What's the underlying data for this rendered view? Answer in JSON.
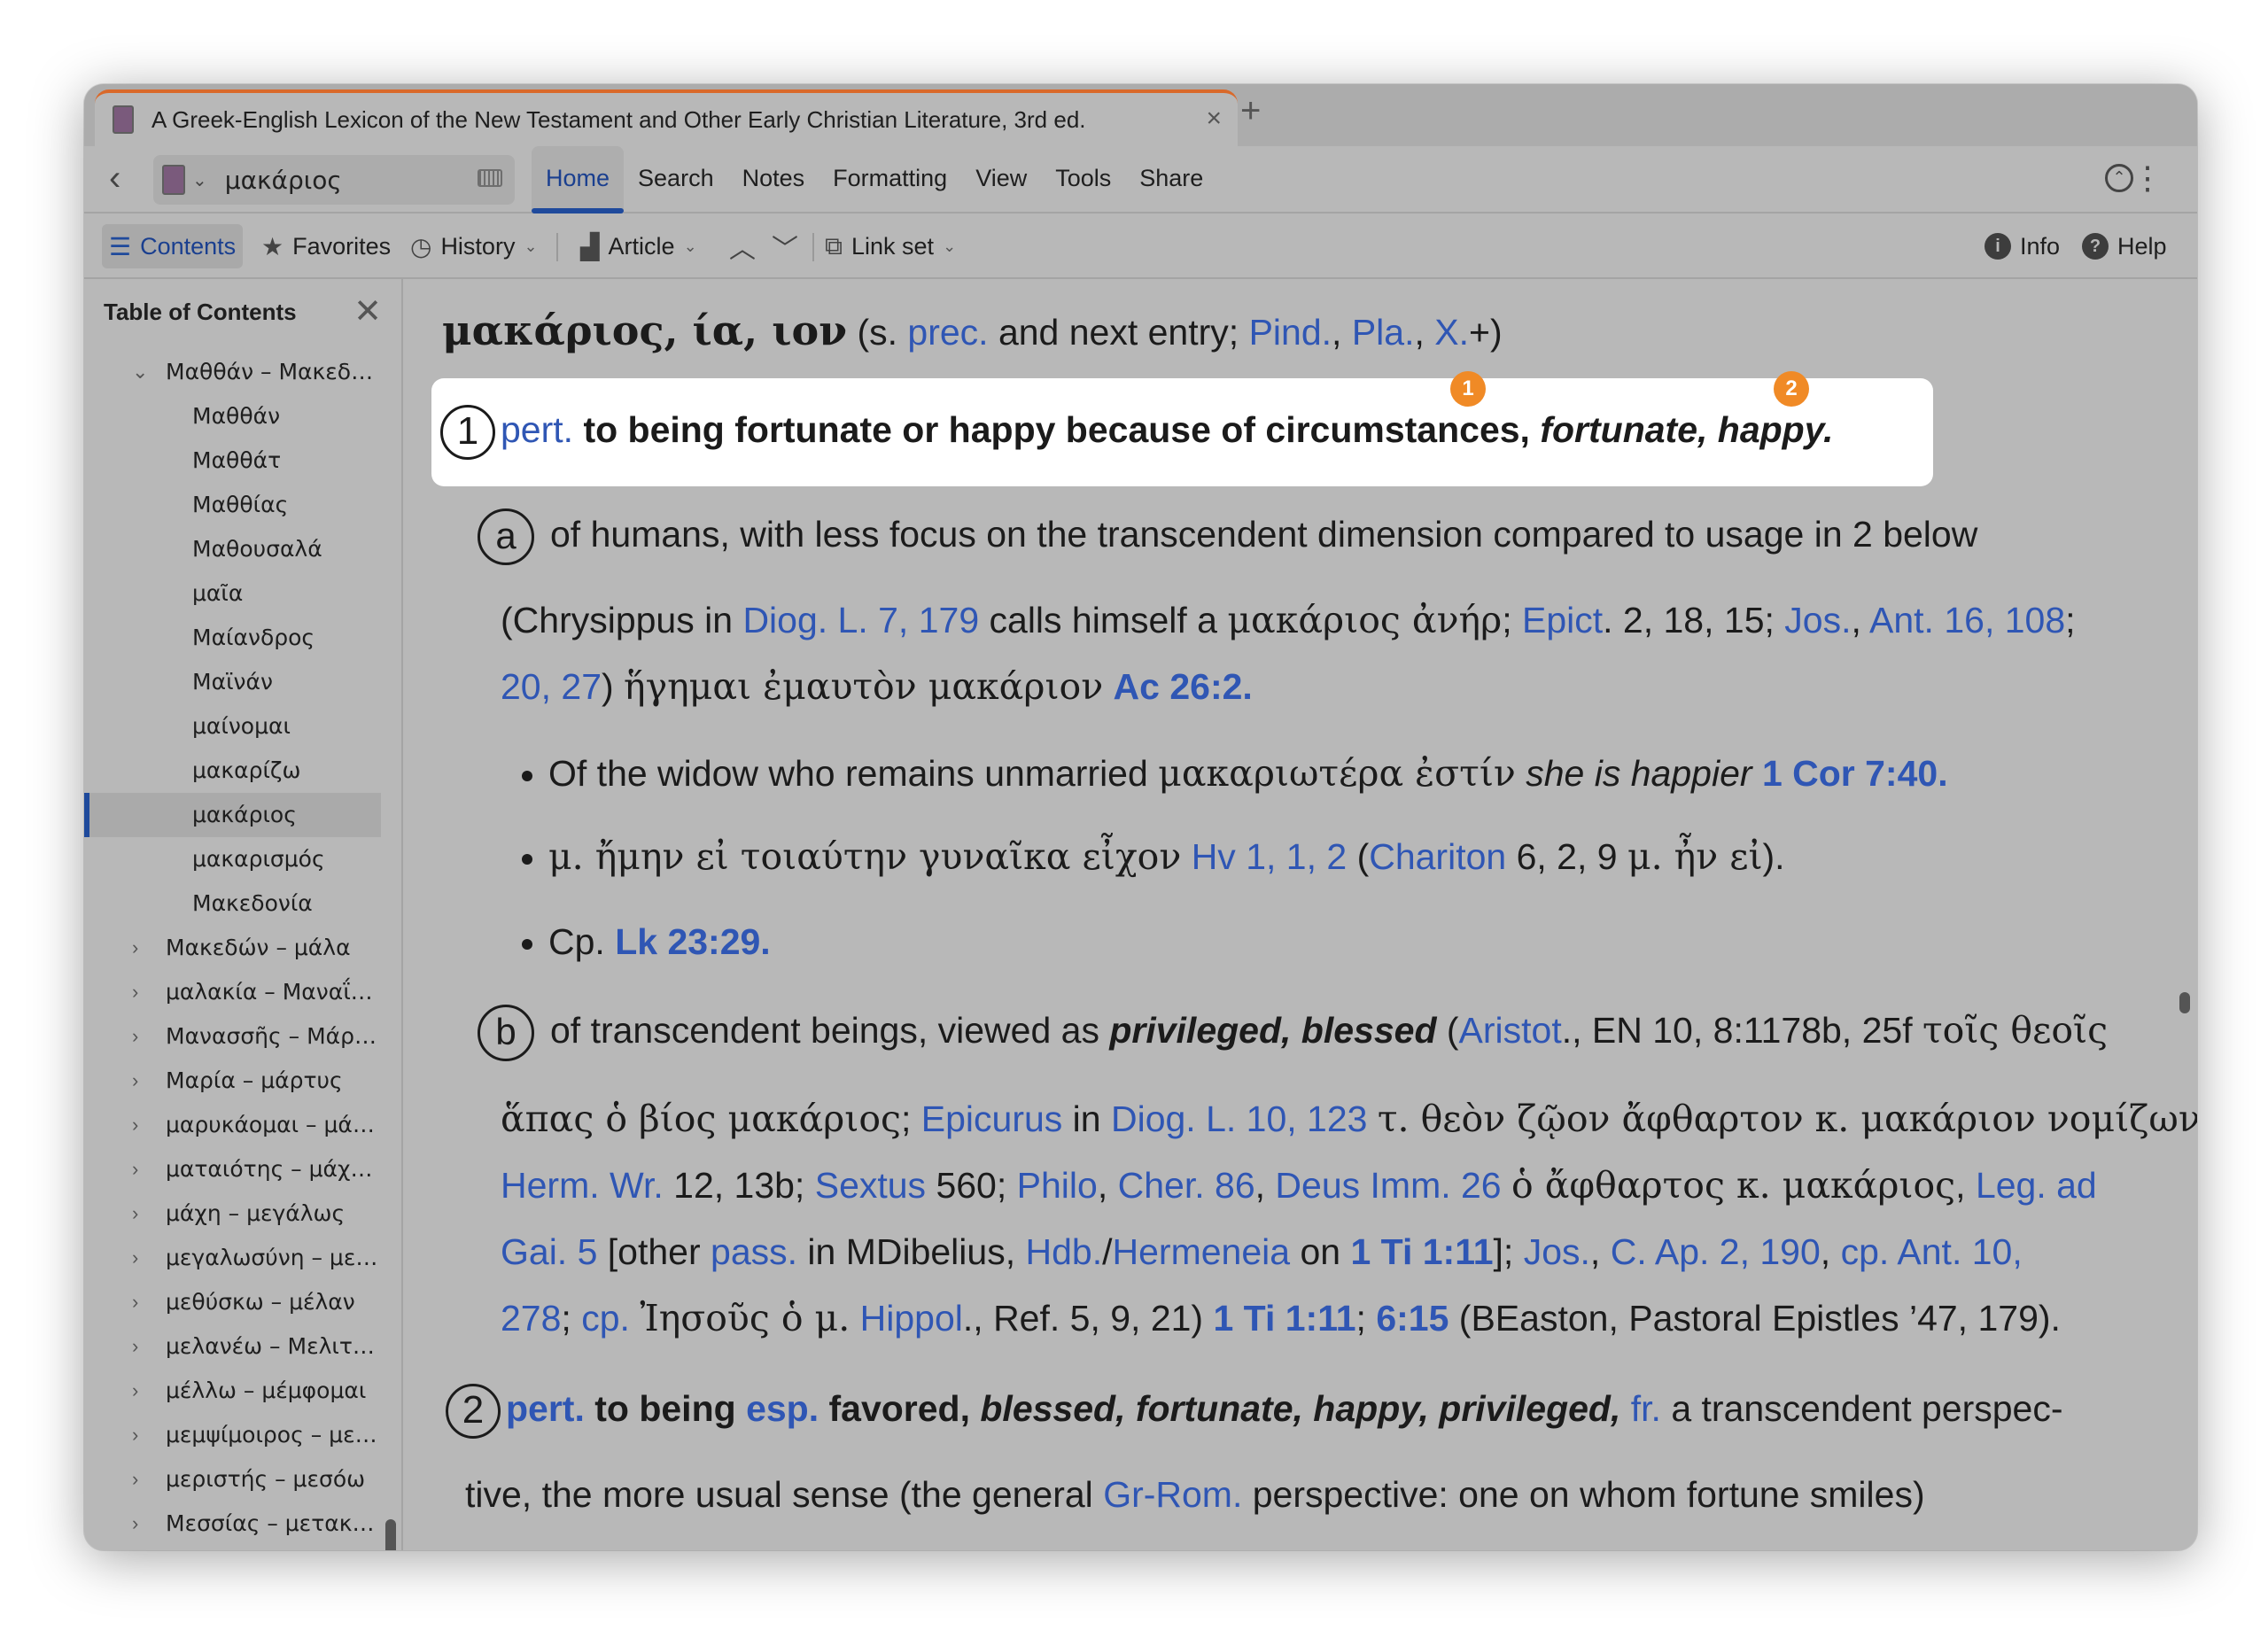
{
  "window": {
    "tab_title": "A Greek-English Lexicon of the New Testament and Other Early Christian Literature, 3rd ed.",
    "tab_close": "×",
    "new_tab": "+"
  },
  "nav": {
    "back": "‹",
    "search_value": "μακάριος",
    "ribbon": [
      "Home",
      "Search",
      "Notes",
      "Formatting",
      "View",
      "Tools",
      "Share"
    ],
    "active_ribbon": "Home"
  },
  "toolbar": {
    "contents": "Contents",
    "favorites": "Favorites",
    "history": "History",
    "article": "Article",
    "linkset": "Link set",
    "info": "Info",
    "help": "Help"
  },
  "sidebar": {
    "title": "Table of Contents",
    "items": [
      {
        "label": "Μαθθάν – Μακεδ…",
        "level": 1,
        "toggle": "⌄"
      },
      {
        "label": "Μαθθάν",
        "level": 2
      },
      {
        "label": "Μαθθάτ",
        "level": 2
      },
      {
        "label": "Μαθθίας",
        "level": 2
      },
      {
        "label": "Μαθουσαλά",
        "level": 2
      },
      {
        "label": "μαῖα",
        "level": 2
      },
      {
        "label": "Μαίανδρος",
        "level": 2
      },
      {
        "label": "Μαϊνάν",
        "level": 2
      },
      {
        "label": "μαίνομαι",
        "level": 2
      },
      {
        "label": "μακαρίζω",
        "level": 2
      },
      {
        "label": "μακάριος",
        "level": 2,
        "selected": true
      },
      {
        "label": "μακαρισμός",
        "level": 2
      },
      {
        "label": "Μακεδονία",
        "level": 2
      },
      {
        "label": "Μακεδών – μάλα",
        "level": 1,
        "toggle": "›"
      },
      {
        "label": "μαλακία – Μαναΐ…",
        "level": 1,
        "toggle": "›"
      },
      {
        "label": "Μανασσῆς – Μάρθα",
        "level": 1,
        "toggle": "›"
      },
      {
        "label": "Μαρία – μάρτυς",
        "level": 1,
        "toggle": "›"
      },
      {
        "label": "μαρυκάομαι – μά…",
        "level": 1,
        "toggle": "›"
      },
      {
        "label": "ματαιότης – μάχα…",
        "level": 1,
        "toggle": "›"
      },
      {
        "label": "μάχη – μεγάλως",
        "level": 1,
        "toggle": "›"
      },
      {
        "label": "μεγαλωσύνη – με…",
        "level": 1,
        "toggle": "›"
      },
      {
        "label": "μεθύσκω – μέλαν",
        "level": 1,
        "toggle": "›"
      },
      {
        "label": "μελανέω – Μελιτ…",
        "level": 1,
        "toggle": "›"
      },
      {
        "label": "μέλλω – μέμφομαι",
        "level": 1,
        "toggle": "›"
      },
      {
        "label": "μεμψίμοιρος – με…",
        "level": 1,
        "toggle": "›"
      },
      {
        "label": "μεριστής – μεσόω",
        "level": 1,
        "toggle": "›"
      },
      {
        "label": "Μεσσίας – μετακα…",
        "level": 1,
        "toggle": "›"
      }
    ]
  },
  "entry": {
    "headword": "μακάριος, ία, ιον",
    "h_open": " (s. ",
    "h_prec": "prec.",
    "h_mid": " and next entry; ",
    "h_pind": "Pind.",
    "h_c1": ", ",
    "h_pla": "Pla.",
    "h_c2": ", ",
    "h_x": "X.",
    "h_close": "+)",
    "s1_num": "1",
    "s1_pert": "pert.",
    "s1_text": " to being fortunate or happy because of circumstances, ",
    "s1_gloss": "fortunate, happy.",
    "badge1": "1",
    "badge2": "2",
    "a_label": "a",
    "a_l1": "of humans, with less focus on the transcendent dimension compared to usage in 2 below",
    "a_l2_open": "(Chrysippus in ",
    "a_l2_diog": "Diog. L. 7, 179",
    "a_l2_mid": " calls himself a ",
    "a_l2_gk": "μακάριος ἀνήρ",
    "a_l2_semi": "; ",
    "a_l2_epict": "Epict",
    "a_l2_ref": ". 2, 18, 15; ",
    "a_l2_jos": "Jos.",
    "a_l2_comma": ", ",
    "a_l2_ant": "Ant. 16, 108",
    "a_l2_end": ";",
    "a_l3_ref": "20, 27",
    "a_l3_close": ") ",
    "a_l3_gk": "ἥγημαι ἐμαυτὸν μακάριον",
    "a_l3_sp": " ",
    "a_l3_ac": "Ac 26:2.",
    "b1_text": "Of the widow who remains unmarried ",
    "b1_gk": "μακαριωτέρα ἐστίν",
    "b1_it": " she is happier",
    "b1_sp": " ",
    "b1_ref": "1 Cor 7:40.",
    "b2_gk": "μ. ἤμην εἰ τοιαύτην γυναῖκα εἶχον",
    "b2_sp": " ",
    "b2_hv": "Hv 1, 1, 2",
    "b2_open": " (",
    "b2_chariton": "Chariton",
    "b2_ref": " 6, 2, 9 ",
    "b2_gk2": "μ. ἦν εἰ",
    "b2_close": ").",
    "b3_text": "Cp. ",
    "b3_ref": "Lk 23:29.",
    "b_label": "b",
    "bl1_text": "of transcendent beings, viewed as ",
    "bl1_it": "privileged, blessed",
    "bl1_open": " (",
    "bl1_aristot": "Aristot",
    "bl1_ref": "., EN 10, 8:1178b, 25f ",
    "bl1_gk": "τοῖς θεοῖς",
    "bl2_gk": "ἅπας ὁ βίος μακάριος",
    "bl2_semi": "; ",
    "bl2_epicurus": "Epicurus",
    "bl2_in": " in ",
    "bl2_diog": "Diog. L. 10, 123",
    "bl2_sp": " ",
    "bl2_gk2": "τ. θεὸν ζῷον ἄφθαρτον κ. μακάριον νομίζων",
    "bl2_end": ";",
    "bl3_herm": "Herm. Wr.",
    "bl3_r1": " 12, 13b; ",
    "bl3_sextus": "Sextus",
    "bl3_r2": " 560; ",
    "bl3_philo": "Philo",
    "bl3_c1": ", ",
    "bl3_cher": "Cher. 86",
    "bl3_c2": ", ",
    "bl3_deus": "Deus Imm. 26",
    "bl3_sp": " ",
    "bl3_gk": "ὁ ἄφθαρτος κ. μακάριος",
    "bl3_c3": ", ",
    "bl3_leg": "Leg. ad",
    "bl4_gai": "Gai. 5",
    "bl4_open": " [other ",
    "bl4_pass": "pass.",
    "bl4_in": " in MDibelius, ",
    "bl4_hdb": "Hdb.",
    "bl4_slash": "/",
    "bl4_herm": "Hermeneia",
    "bl4_on": " on ",
    "bl4_ti": "1 Ti 1:11",
    "bl4_close": "]; ",
    "bl4_jos": "Jos.",
    "bl4_c1": ", ",
    "bl4_cap": "C. Ap. 2, 190",
    "bl4_c2": ", ",
    "bl4_cp": "cp. Ant. 10,",
    "bl5_278": "278",
    "bl5_semi": "; ",
    "bl5_cp": "cp.",
    "bl5_sp": " ",
    "bl5_gk": "Ἰησοῦς ὁ μ.",
    "bl5_sp2": " ",
    "bl5_hippol": "Hippol",
    "bl5_ref": "., Ref. 5, 9, 21) ",
    "bl5_ti1": "1 Ti 1:11",
    "bl5_semi2": "; ",
    "bl5_ti2": "6:15",
    "bl5_end": " (BEaston, Pastoral Epistles ’47, 179).",
    "s2_num": "2",
    "s2_pert": "pert.",
    "s2_to": " to being ",
    "s2_esp": "esp.",
    "s2_fav": " favored, ",
    "s2_it": "blessed, fortunate, happy, privileged,",
    "s2_sp": " ",
    "s2_fr": "fr.",
    "s2_rest": " a transcendent perspec-",
    "s2b_text": "tive, the more usual sense (the general ",
    "s2b_grrom": "Gr-Rom.",
    "s2b_rest": " perspective: one on whom fortune smiles)"
  },
  "colors": {
    "link": "#2f56b4",
    "accent": "#1f4a9c",
    "badge": "#f08a26",
    "tab_top": "#d9692a"
  }
}
